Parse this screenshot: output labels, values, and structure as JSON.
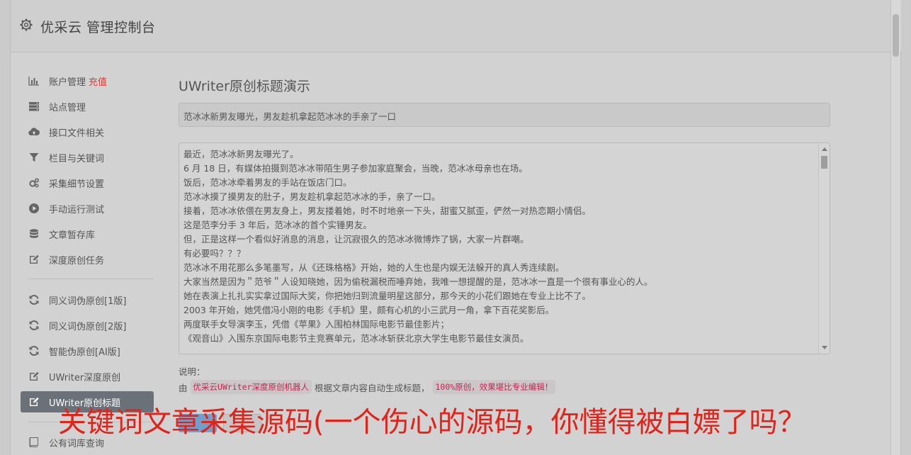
{
  "app": {
    "title": "优采云 管理控制台"
  },
  "sidebar": {
    "items": [
      {
        "label": "账户管理",
        "extra": "充值",
        "icon": "bar-chart-icon"
      },
      {
        "label": "站点管理",
        "icon": "server-icon"
      },
      {
        "label": "接口文件相关",
        "icon": "cloud-upload-icon"
      },
      {
        "label": "栏目与关键词",
        "icon": "filter-icon"
      },
      {
        "label": "采集细节设置",
        "icon": "cogs-icon"
      },
      {
        "label": "手动运行测试",
        "icon": "play-circle-icon"
      },
      {
        "label": "文章暂存库",
        "icon": "database-icon"
      },
      {
        "label": "深度原创任务",
        "icon": "edit-icon"
      },
      {
        "label": "同义词伪原创[1版]",
        "icon": "refresh-icon"
      },
      {
        "label": "同义词伪原创[2版]",
        "icon": "refresh-icon"
      },
      {
        "label": "智能伪原创[AI版]",
        "icon": "refresh-icon"
      },
      {
        "label": "UWriter深度原创",
        "icon": "edit-icon"
      },
      {
        "label": "UWriter原创标题",
        "icon": "edit-icon",
        "active": true
      },
      {
        "label": "公有词库查询",
        "icon": "book-icon"
      }
    ]
  },
  "main": {
    "heading": "UWriter原创标题演示",
    "title_value": "范冰冰新男友曝光，男友趁机拿起范冰冰的手亲了一口",
    "content_lines": [
      "最近，范冰冰新男友曝光了。",
      "6 月 18 日，有媒体拍摄到范冰冰带陌生男子参加家庭聚会，当晚，范冰冰母亲也在场。",
      "饭后，范冰冰牵着男友的手站在饭店门口。",
      "范冰冰摸了摸男友的肚子，男友趁机拿起范冰冰的手，亲了一口。",
      "接着，范冰冰依偎在男友身上，男友搂着她，时不时地亲一下头，甜蜜又腻歪，俨然一对热恋期小情侣。",
      "这是范李分手 3 年后，范冰冰的首个实锤男友。",
      "但，正是这样一个看似好消息的消息，让沉寂很久的范冰冰微博炸了锅，大家一片群嘲。",
      "有必要吗？？？",
      "范冰冰不用花那么多笔墨写，从《还珠格格》开始，她的人生也是内娱无法躲开的真人秀连续剧。",
      "大家当然是因为＂范爷＂人设知晓她，因为偷税漏税而唾弃她，我唯一想提醒的是，范冰冰一直是一个很有事业心的人。",
      "她在表演上扎扎实实拿过国际大奖，你把她归到流量明星这部分，那今天的小花们跟她在专业上比不了。",
      "2003 年开始，她凭借冯小刚的电影《手机》里，颇有心机的小三武月一角，拿下百花奖影后。",
      "两度联手女导演李玉，凭借《苹果》入围柏林国际电影节最佳影片；",
      "《观音山》入围东京国际电影节主竞赛单元，范冰冰斩获北京大学生电影节最佳女演员。"
    ],
    "note_label": "说明：",
    "note_prefix": "由",
    "note_code1": "优采云UWriter深度原创机器人",
    "note_middle": "根据文章内容自动生成标题，",
    "note_code2": "100%原创，效果堪比专业编辑！"
  },
  "overlay": {
    "text": "关键词文章采集源码(一个伤心的源码，你懂得被白嫖了吗？"
  },
  "colors": {
    "accent_red": "#e2231a",
    "active_bg": "#6a7178",
    "code_red": "#c7254e"
  }
}
